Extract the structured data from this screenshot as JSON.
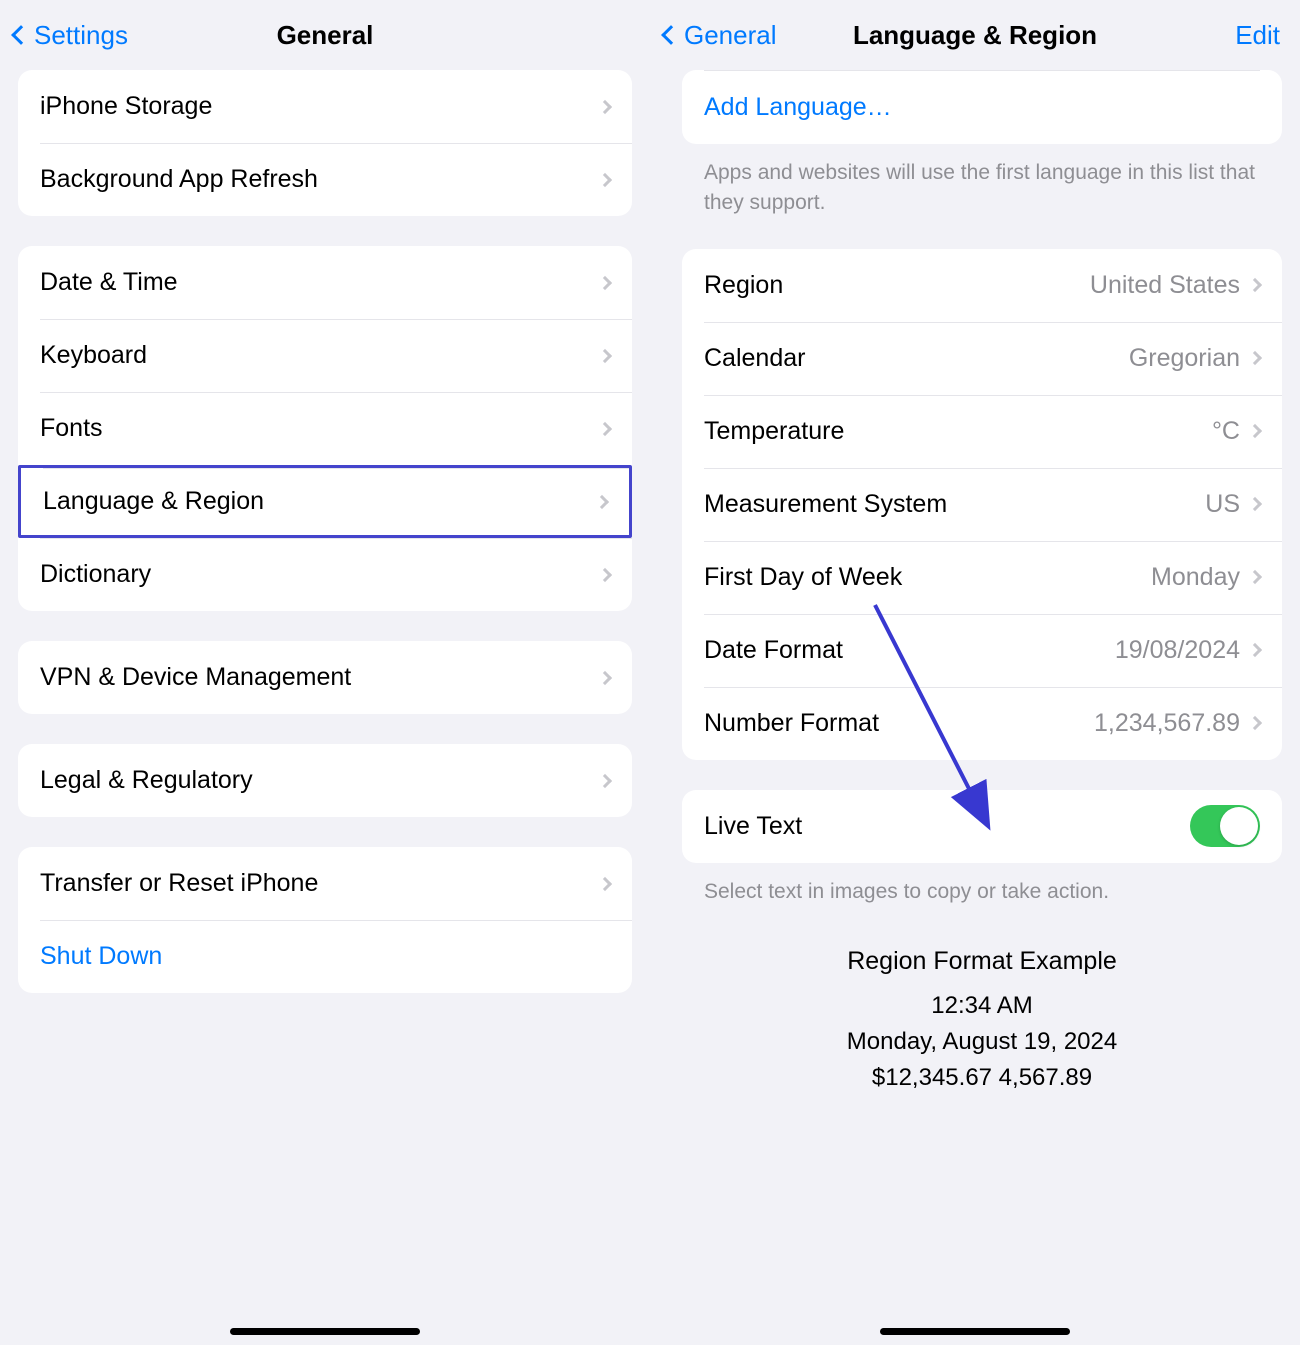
{
  "left": {
    "back_label": "Settings",
    "title": "General",
    "group1": [
      {
        "label": "iPhone Storage"
      },
      {
        "label": "Background App Refresh"
      }
    ],
    "group2": [
      {
        "label": "Date & Time"
      },
      {
        "label": "Keyboard"
      },
      {
        "label": "Fonts"
      },
      {
        "label": "Language & Region",
        "highlighted": true
      },
      {
        "label": "Dictionary"
      }
    ],
    "group3": [
      {
        "label": "VPN & Device Management"
      }
    ],
    "group4": [
      {
        "label": "Legal & Regulatory"
      }
    ],
    "group5": [
      {
        "label": "Transfer or Reset iPhone"
      },
      {
        "label": "Shut Down",
        "style": "link"
      }
    ]
  },
  "right": {
    "back_label": "General",
    "title": "Language & Region",
    "edit_label": "Edit",
    "add_language": "Add Language…",
    "languages_footer": "Apps and websites will use the first language in this list that they support.",
    "region_rows": {
      "region": {
        "label": "Region",
        "value": "United States"
      },
      "calendar": {
        "label": "Calendar",
        "value": "Gregorian"
      },
      "temperature": {
        "label": "Temperature",
        "value": "°C"
      },
      "measurement": {
        "label": "Measurement System",
        "value": "US"
      },
      "first_day": {
        "label": "First Day of Week",
        "value": "Monday"
      },
      "date_format": {
        "label": "Date Format",
        "value": "19/08/2024"
      },
      "number_format": {
        "label": "Number Format",
        "value": "1,234,567.89"
      }
    },
    "live_text": {
      "label": "Live Text",
      "on": true
    },
    "live_text_footer": "Select text in images to copy or take action.",
    "example": {
      "title": "Region Format Example",
      "time": "12:34 AM",
      "date": "Monday, August 19, 2024",
      "currency": "$12,345.67   4,567.89"
    }
  }
}
